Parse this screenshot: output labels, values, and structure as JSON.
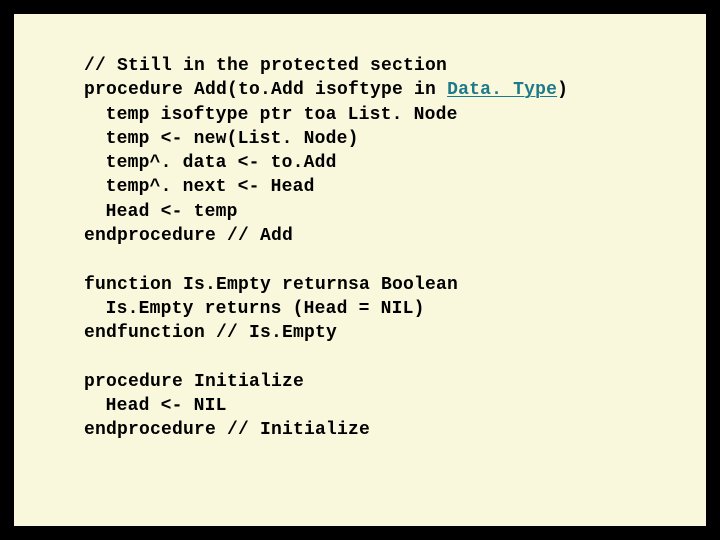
{
  "code": {
    "l1": "// Still in the protected section",
    "l2a": "procedure Add(to.Add isoftype in ",
    "l2b": "Data. Type",
    "l2c": ")",
    "l3": "temp isoftype ptr toa List. Node",
    "l4": "temp <- new(List. Node)",
    "l5": "temp^. data <- to.Add",
    "l6": "temp^. next <- Head",
    "l7": "Head <- temp",
    "l8": "endprocedure // Add",
    "l9": "function Is.Empty returnsa Boolean",
    "l10": "Is.Empty returns (Head = NIL)",
    "l11": "endfunction // Is.Empty",
    "l12": "procedure Initialize",
    "l13": "Head <- NIL",
    "l14": "endprocedure // Initialize"
  }
}
